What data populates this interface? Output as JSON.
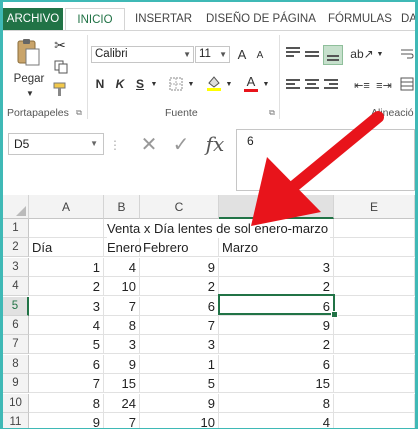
{
  "ribbon_tabs": [
    "ARCHIVO",
    "INICIO",
    "INSERTAR",
    "DISEÑO DE PÁGINA",
    "FÓRMULAS",
    "DA"
  ],
  "clipboard": {
    "paste_label": "Pegar",
    "group_label": "Portapapeles"
  },
  "font": {
    "name": "Calibri",
    "size": "11",
    "bold": "N",
    "italic": "K",
    "underline": "S",
    "grow": "A",
    "shrink": "A",
    "color_a": "A",
    "group_label": "Fuente"
  },
  "alignment": {
    "group_label": "Alineació"
  },
  "namebox": {
    "value": "D5"
  },
  "formula": {
    "fx": "fx",
    "cancel": "✕",
    "enter": "✓",
    "value": "6"
  },
  "columns": [
    "A",
    "B",
    "C",
    "D",
    "E"
  ],
  "rows": [
    {
      "n": "1",
      "a": "",
      "b": "",
      "c": "",
      "d": ""
    },
    {
      "n": "2",
      "a": "Día",
      "b": "Enero",
      "c": "Febrero",
      "d": "Marzo"
    },
    {
      "n": "3",
      "a": "1",
      "b": "4",
      "c": "9",
      "d": "3"
    },
    {
      "n": "4",
      "a": "2",
      "b": "10",
      "c": "2",
      "d": "2"
    },
    {
      "n": "5",
      "a": "3",
      "b": "7",
      "c": "6",
      "d": "6"
    },
    {
      "n": "6",
      "a": "4",
      "b": "8",
      "c": "7",
      "d": "9"
    },
    {
      "n": "7",
      "a": "5",
      "b": "3",
      "c": "3",
      "d": "2"
    },
    {
      "n": "8",
      "a": "6",
      "b": "9",
      "c": "1",
      "d": "6"
    },
    {
      "n": "9",
      "a": "7",
      "b": "15",
      "c": "5",
      "d": "15"
    },
    {
      "n": "10",
      "a": "8",
      "b": "24",
      "c": "9",
      "d": "8"
    },
    {
      "n": "11",
      "a": "9",
      "b": "7",
      "c": "10",
      "d": "4"
    }
  ],
  "title_cell": "Venta x Día lentes de sol enero-marzo",
  "colors": {
    "excel_green": "#217346",
    "selected_border": "#217346",
    "arrow_red": "#e8141b",
    "background": "#3fb9b6"
  }
}
